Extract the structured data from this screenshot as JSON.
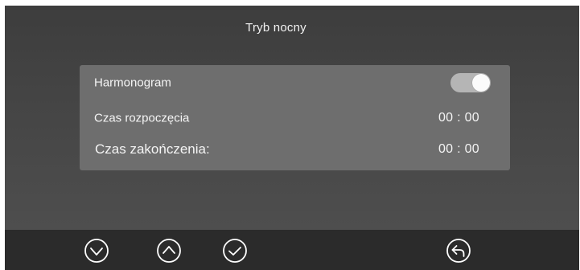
{
  "screen": {
    "title": "Tryb nocny"
  },
  "settings": {
    "schedule": {
      "label": "Harmonogram",
      "enabled": true
    },
    "start_time": {
      "label": "Czas rozpoczęcia",
      "value": "00 : 00"
    },
    "end_time": {
      "label": "Czas zakończenia:",
      "value": "00 : 00"
    }
  },
  "bottom_bar": {
    "buttons": [
      {
        "icon": "chevron-down-icon"
      },
      {
        "icon": "chevron-up-icon"
      },
      {
        "icon": "check-icon"
      },
      {
        "icon": "back-icon"
      }
    ]
  },
  "colors": {
    "background": "#454545",
    "panel": "#6e6e6e",
    "bottom_bar": "#2b2b2b",
    "toggle_on": "#b5b5b5",
    "text": "#f4f4f4"
  }
}
